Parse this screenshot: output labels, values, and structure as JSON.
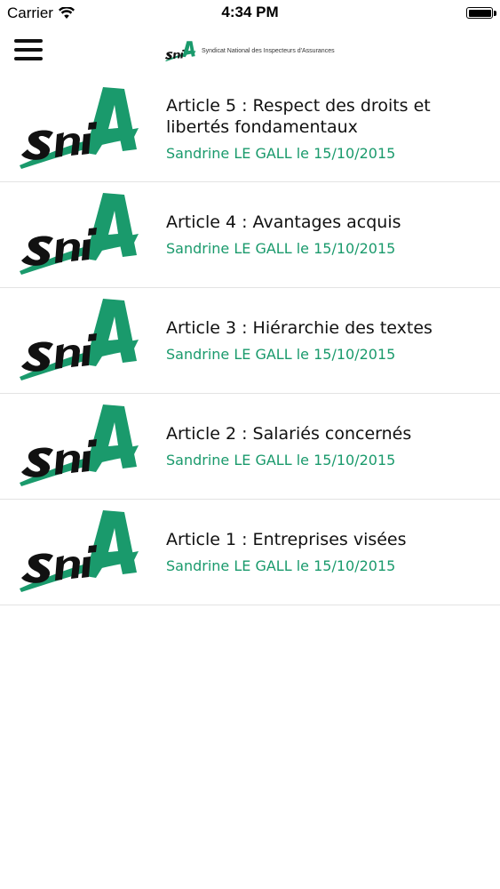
{
  "status_bar": {
    "carrier": "Carrier",
    "time": "4:34 PM",
    "battery_level": 1.0
  },
  "header": {
    "logo_text": "Syndicat National des Inspecteurs d'Assurances"
  },
  "colors": {
    "accent": "#1a9a6c",
    "title": "#111111"
  },
  "articles": [
    {
      "title": "Article 5 : Respect des droits et libertés fondamentaux",
      "subtitle": "Sandrine LE GALL le 15/10/2015"
    },
    {
      "title": "Article 4 : Avantages acquis",
      "subtitle": "Sandrine LE GALL le 15/10/2015"
    },
    {
      "title": "Article 3 : Hiérarchie des textes",
      "subtitle": "Sandrine LE GALL le 15/10/2015"
    },
    {
      "title": "Article 2 : Salariés concernés",
      "subtitle": "Sandrine LE GALL le 15/10/2015"
    },
    {
      "title": "Article 1 : Entreprises visées",
      "subtitle": "Sandrine LE GALL le 15/10/2015"
    }
  ]
}
